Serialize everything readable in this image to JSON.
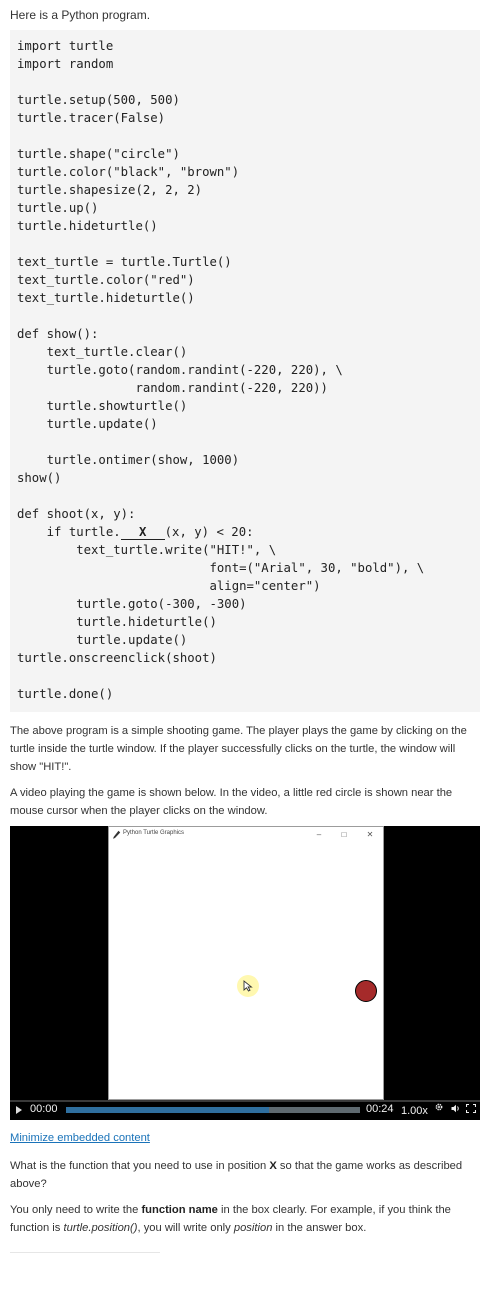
{
  "intro": "Here is a Python program.",
  "code": {
    "lines": [
      "import turtle",
      "import random",
      "",
      "turtle.setup(500, 500)",
      "turtle.tracer(False)",
      "",
      "turtle.shape(\"circle\")",
      "turtle.color(\"black\", \"brown\")",
      "turtle.shapesize(2, 2, 2)",
      "turtle.up()",
      "turtle.hideturtle()",
      "",
      "text_turtle = turtle.Turtle()",
      "text_turtle.color(\"red\")",
      "text_turtle.hideturtle()",
      "",
      "def show():",
      "    text_turtle.clear()",
      "    turtle.goto(random.randint(-220, 220), \\",
      "                random.randint(-220, 220))",
      "    turtle.showturtle()",
      "    turtle.update()",
      "",
      "    turtle.ontimer(show, 1000)",
      "show()",
      "",
      "def shoot(x, y):"
    ],
    "blank_line": {
      "before": "    if turtle.",
      "blank": "X",
      "after": "(x, y) < 20:"
    },
    "lines_after": [
      "        text_turtle.write(\"HIT!\", \\",
      "                          font=(\"Arial\", 30, \"bold\"), \\",
      "                          align=\"center\")",
      "        turtle.goto(-300, -300)",
      "        turtle.hideturtle()",
      "        turtle.update()",
      "turtle.onscreenclick(shoot)",
      "",
      "turtle.done()"
    ]
  },
  "description": "The above program is a simple shooting game. The player plays the game by clicking on the turtle inside the turtle window. If the player successfully clicks on the turtle, the window will show \"HIT!\".",
  "video_intro": "A video playing the game is shown below. In the video, a little red circle is shown near the mouse cursor when the player clicks on the window.",
  "video": {
    "window_title": "Python Turtle Graphics",
    "min_glyph": "–",
    "max_glyph": "□",
    "close_glyph": "✕",
    "time_start": "00:00",
    "time_end": "00:24",
    "speed": "1.00x",
    "buffered_fraction": 0.69,
    "turtle_fill": "#a52a2a",
    "turtle_outline": "#000000",
    "progress_color": "#2f6f9f",
    "icons": [
      "play-icon",
      "gear-icon",
      "volume-icon",
      "fullscreen-icon",
      "pen-icon",
      "cursor-icon"
    ]
  },
  "minimize_link": "Minimize embedded content",
  "question": {
    "part1": "What is the function that you need to use in position ",
    "x": "X",
    "part2": " so that the game works as described above?"
  },
  "instruction": {
    "p1": "You only need to write the ",
    "bold": "function name",
    "p2": " in the box clearly. For example, if you think the function is ",
    "ex1": "turtle.position()",
    "p3": ", you will write only ",
    "ex2": "position",
    "p4": " in the answer box."
  },
  "colors": {
    "link": "#1a73b9",
    "code_bg": "#f4f4f4"
  }
}
